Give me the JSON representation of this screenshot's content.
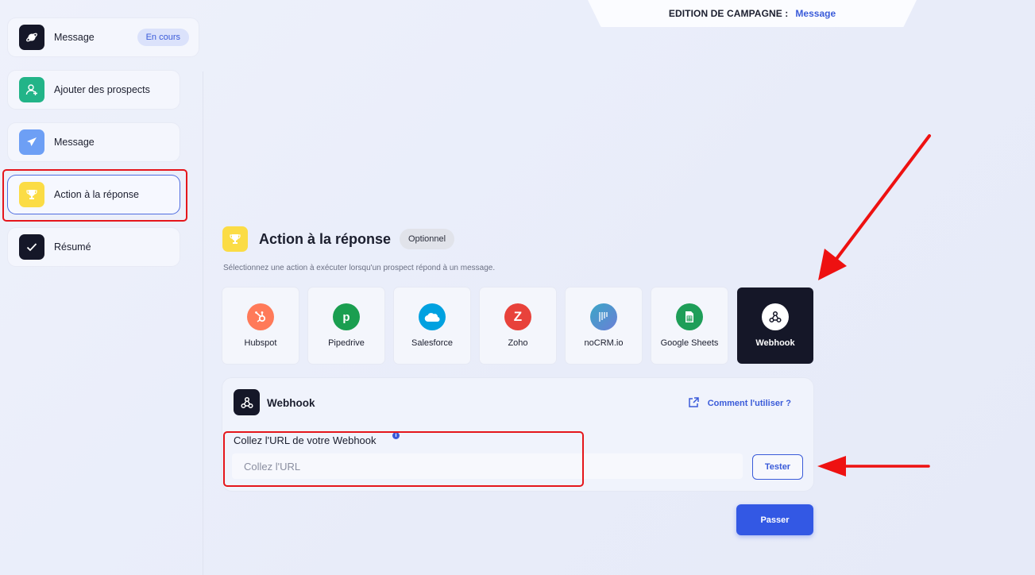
{
  "header": {
    "edition_label": "EDITION DE CAMPAGNE :",
    "edition_value": "Message"
  },
  "sidebar": {
    "items": [
      {
        "label": "Message",
        "icon": "planet-icon",
        "badge": "En cours"
      },
      {
        "label": "Ajouter des prospects",
        "icon": "user-add-icon"
      },
      {
        "label": "Message",
        "icon": "paper-plane-icon"
      },
      {
        "label": "Action à la réponse",
        "icon": "trophy-icon"
      },
      {
        "label": "Résumé",
        "icon": "check-icon"
      }
    ]
  },
  "section": {
    "title": "Action à la réponse",
    "badge": "Optionnel",
    "description": "Sélectionnez une action à exécuter lorsqu'un prospect répond à un message."
  },
  "integrations": [
    {
      "label": "Hubspot",
      "color": "#ff7a59",
      "glyph": ""
    },
    {
      "label": "Pipedrive",
      "color": "#1a9e50",
      "glyph": "p"
    },
    {
      "label": "Salesforce",
      "color": "#00a1e0",
      "glyph": ""
    },
    {
      "label": "Zoho",
      "color": "#e8423b",
      "glyph": "Z"
    },
    {
      "label": "noCRM.io",
      "color": "#3aa6c7",
      "glyph": ""
    },
    {
      "label": "Google Sheets",
      "color": "#1e9e58",
      "glyph": ""
    },
    {
      "label": "Webhook",
      "color": "#ffffff",
      "glyph": ""
    }
  ],
  "webhook": {
    "title": "Webhook",
    "help_link": "Comment l'utiliser ?",
    "field_label": "Collez l'URL de votre Webhook",
    "info_glyph": "i",
    "url_value": "",
    "url_placeholder": "Collez l'URL",
    "test_label": "Tester"
  },
  "footer": {
    "next_label": "Passer"
  },
  "colors": {
    "accent": "#3358e4",
    "annotation": "#e5161b"
  }
}
